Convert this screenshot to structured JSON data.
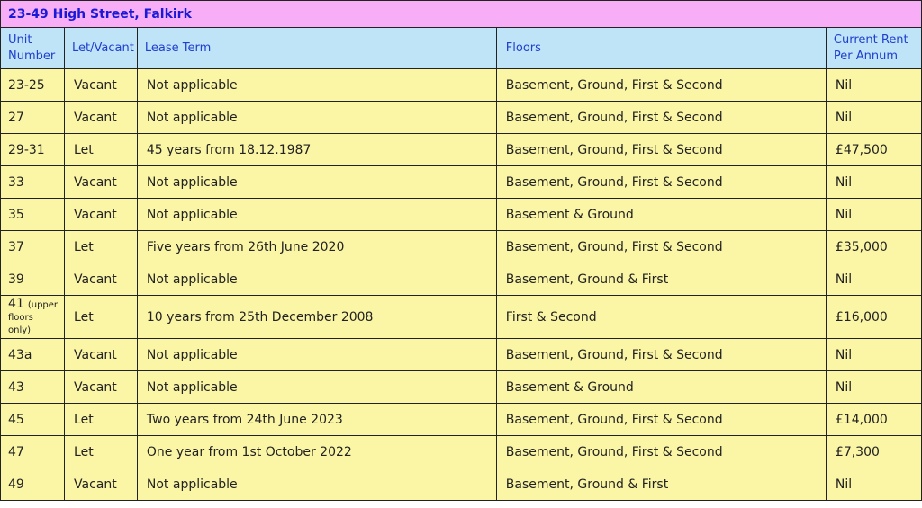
{
  "title": "23-49 High Street, Falkirk",
  "colors": {
    "title_bg": "#f7aef7",
    "title_text": "#1a1ad6",
    "header_bg": "#bfe3f7",
    "header_text": "#1f3fcf",
    "row_bg": "#fbf5a6"
  },
  "headers": {
    "unit": "Unit Number",
    "let": "Let/Vacant",
    "term": "Lease Term",
    "floors": "Floors",
    "rent": "Current Rent Per Annum"
  },
  "rows": [
    {
      "unit": "23-25",
      "note": "",
      "let": "Vacant",
      "term": "Not applicable",
      "floors": "Basement, Ground, First & Second",
      "rent": "Nil"
    },
    {
      "unit": "27",
      "note": "",
      "let": "Vacant",
      "term": "Not applicable",
      "floors": "Basement, Ground, First & Second",
      "rent": "Nil"
    },
    {
      "unit": "29-31",
      "note": "",
      "let": "Let",
      "term": "45 years from 18.12.1987",
      "floors": "Basement, Ground, First & Second",
      "rent": "£47,500"
    },
    {
      "unit": "33",
      "note": "",
      "let": "Vacant",
      "term": "Not applicable",
      "floors": "Basement, Ground, First & Second",
      "rent": "Nil"
    },
    {
      "unit": "35",
      "note": "",
      "let": "Vacant",
      "term": "Not applicable",
      "floors": "Basement & Ground",
      "rent": "Nil"
    },
    {
      "unit": "37",
      "note": "",
      "let": "Let",
      "term": "Five years from 26th June 2020",
      "floors": "Basement, Ground, First & Second",
      "rent": "£35,000"
    },
    {
      "unit": "39",
      "note": "",
      "let": "Vacant",
      "term": "Not applicable",
      "floors": "Basement, Ground & First",
      "rent": "Nil"
    },
    {
      "unit": "41",
      "note": "(upper floors only)",
      "let": "Let",
      "term": "10 years from 25th December 2008",
      "floors": "First & Second",
      "rent": "£16,000"
    },
    {
      "unit": "43a",
      "note": "",
      "let": "Vacant",
      "term": "Not applicable",
      "floors": "Basement, Ground, First & Second",
      "rent": "Nil"
    },
    {
      "unit": "43",
      "note": "",
      "let": "Vacant",
      "term": "Not applicable",
      "floors": "Basement & Ground",
      "rent": "Nil"
    },
    {
      "unit": "45",
      "note": "",
      "let": "Let",
      "term": "Two years from 24th June 2023",
      "floors": "Basement, Ground, First & Second",
      "rent": "£14,000"
    },
    {
      "unit": "47",
      "note": "",
      "let": "Let",
      "term": "One year from 1st October 2022",
      "floors": "Basement, Ground, First & Second",
      "rent": "£7,300"
    },
    {
      "unit": "49",
      "note": "",
      "let": "Vacant",
      "term": "Not applicable",
      "floors": "Basement, Ground & First",
      "rent": "Nil"
    }
  ]
}
